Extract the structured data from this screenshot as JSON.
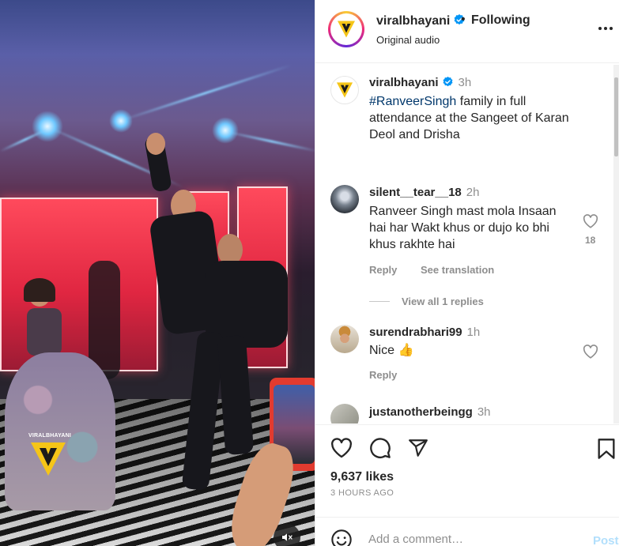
{
  "media": {
    "watermark": "VIRALBHAYANI",
    "mute_icon": "speaker-muted-icon"
  },
  "header": {
    "username": "viralbhayani",
    "bullet": "•",
    "follow_state": "Following",
    "audio": "Original audio",
    "more_icon": "more-horizontal-icon"
  },
  "caption": {
    "username": "viralbhayani",
    "time": "3h",
    "hashtag": "#RanveerSingh",
    "text": " family in full attendance at the Sangeet of Karan Deol and Drisha"
  },
  "comments": [
    {
      "username": "silent__tear__18",
      "time": "2h",
      "text": "Ranveer Singh mast mola Insaan hai har Wakt khus or dujo ko bhi khus rakhte hai",
      "likes": "18",
      "reply": "Reply",
      "translate": "See translation",
      "view_replies": "View all 1 replies"
    },
    {
      "username": "surendrabhari99",
      "time": "1h",
      "text": "Nice 👍",
      "reply": "Reply"
    },
    {
      "username": "justanotherbeingg",
      "time": "3h"
    }
  ],
  "actions": {
    "likes": "9,637 likes",
    "posted": "3 HOURS AGO"
  },
  "add_comment": {
    "placeholder": "Add a comment…",
    "post_label": "Post"
  },
  "colors": {
    "verified": "#0095f6",
    "link": "#00376b",
    "secondary_text": "#8e8e8e",
    "post_disabled": "#b2dffc",
    "brand_yellow": "#f5c518"
  }
}
